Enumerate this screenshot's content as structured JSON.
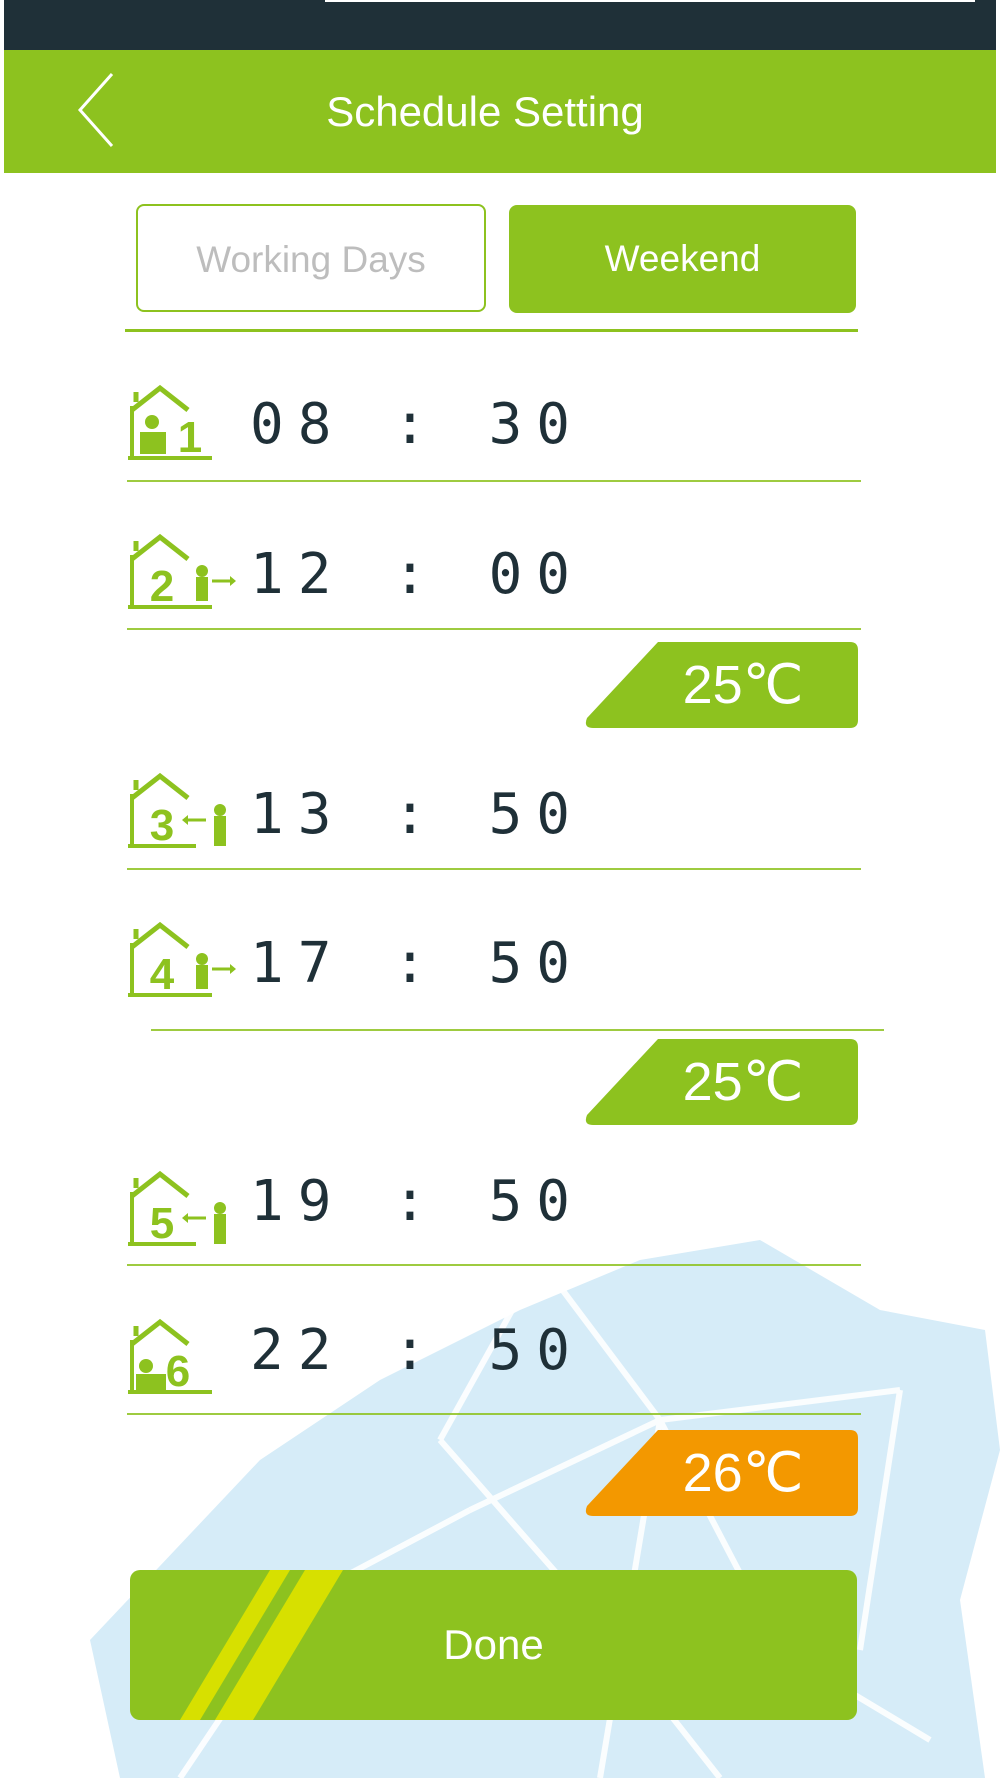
{
  "header": {
    "title": "Schedule Setting",
    "back_icon": "chevron-left-icon"
  },
  "tabs": [
    {
      "label": "Working  Days",
      "selected": false
    },
    {
      "label": "Weekend",
      "selected": true
    }
  ],
  "periods": [
    {
      "number": "1",
      "time": "08 : 30",
      "icon": "home-wake-icon"
    },
    {
      "number": "2",
      "time": "12 : 00",
      "icon": "home-leave-icon"
    },
    {
      "number": "3",
      "time": "13 : 50",
      "icon": "home-return-icon"
    },
    {
      "number": "4",
      "time": "17 : 50",
      "icon": "home-leave-icon"
    },
    {
      "number": "5",
      "time": "19 : 50",
      "icon": "home-return-icon"
    },
    {
      "number": "6",
      "time": "22 : 50",
      "icon": "home-sleep-icon"
    }
  ],
  "temps": [
    {
      "value": "25℃",
      "color": "#8dc21f"
    },
    {
      "value": "25℃",
      "color": "#8dc21f"
    },
    {
      "value": "26℃",
      "color": "#f39800"
    }
  ],
  "done_label": "Done",
  "colors": {
    "accent": "#8dc21f",
    "dark": "#1f3038",
    "warm": "#f39800",
    "stripe": "#d7e000",
    "ice": "#d6ecf8"
  }
}
